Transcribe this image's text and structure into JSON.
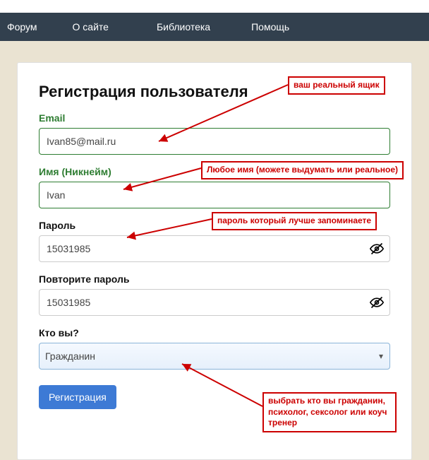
{
  "nav": {
    "items": [
      "Форум",
      "О сайте",
      "Библиотека",
      "Помощь"
    ]
  },
  "form": {
    "title": "Регистрация пользователя",
    "email": {
      "label": "Email",
      "value": "Ivan85@mail.ru"
    },
    "nick": {
      "label": "Имя (Никнейм)",
      "value": "Ivan"
    },
    "pw": {
      "label": "Пароль",
      "value": "15031985"
    },
    "pw2": {
      "label": "Повторите пароль",
      "value": "15031985"
    },
    "role": {
      "label": "Кто вы?",
      "selected": "Гражданин"
    },
    "submit": "Регистрация"
  },
  "annotations": {
    "a1": "ваш реальный ящик",
    "a2": "Любое имя (можете выдумать или реальное)",
    "a3": "пароль который лучше запоминаете",
    "a4": "выбрать кто вы гражданин, психолог, сексолог или коуч тренер"
  }
}
